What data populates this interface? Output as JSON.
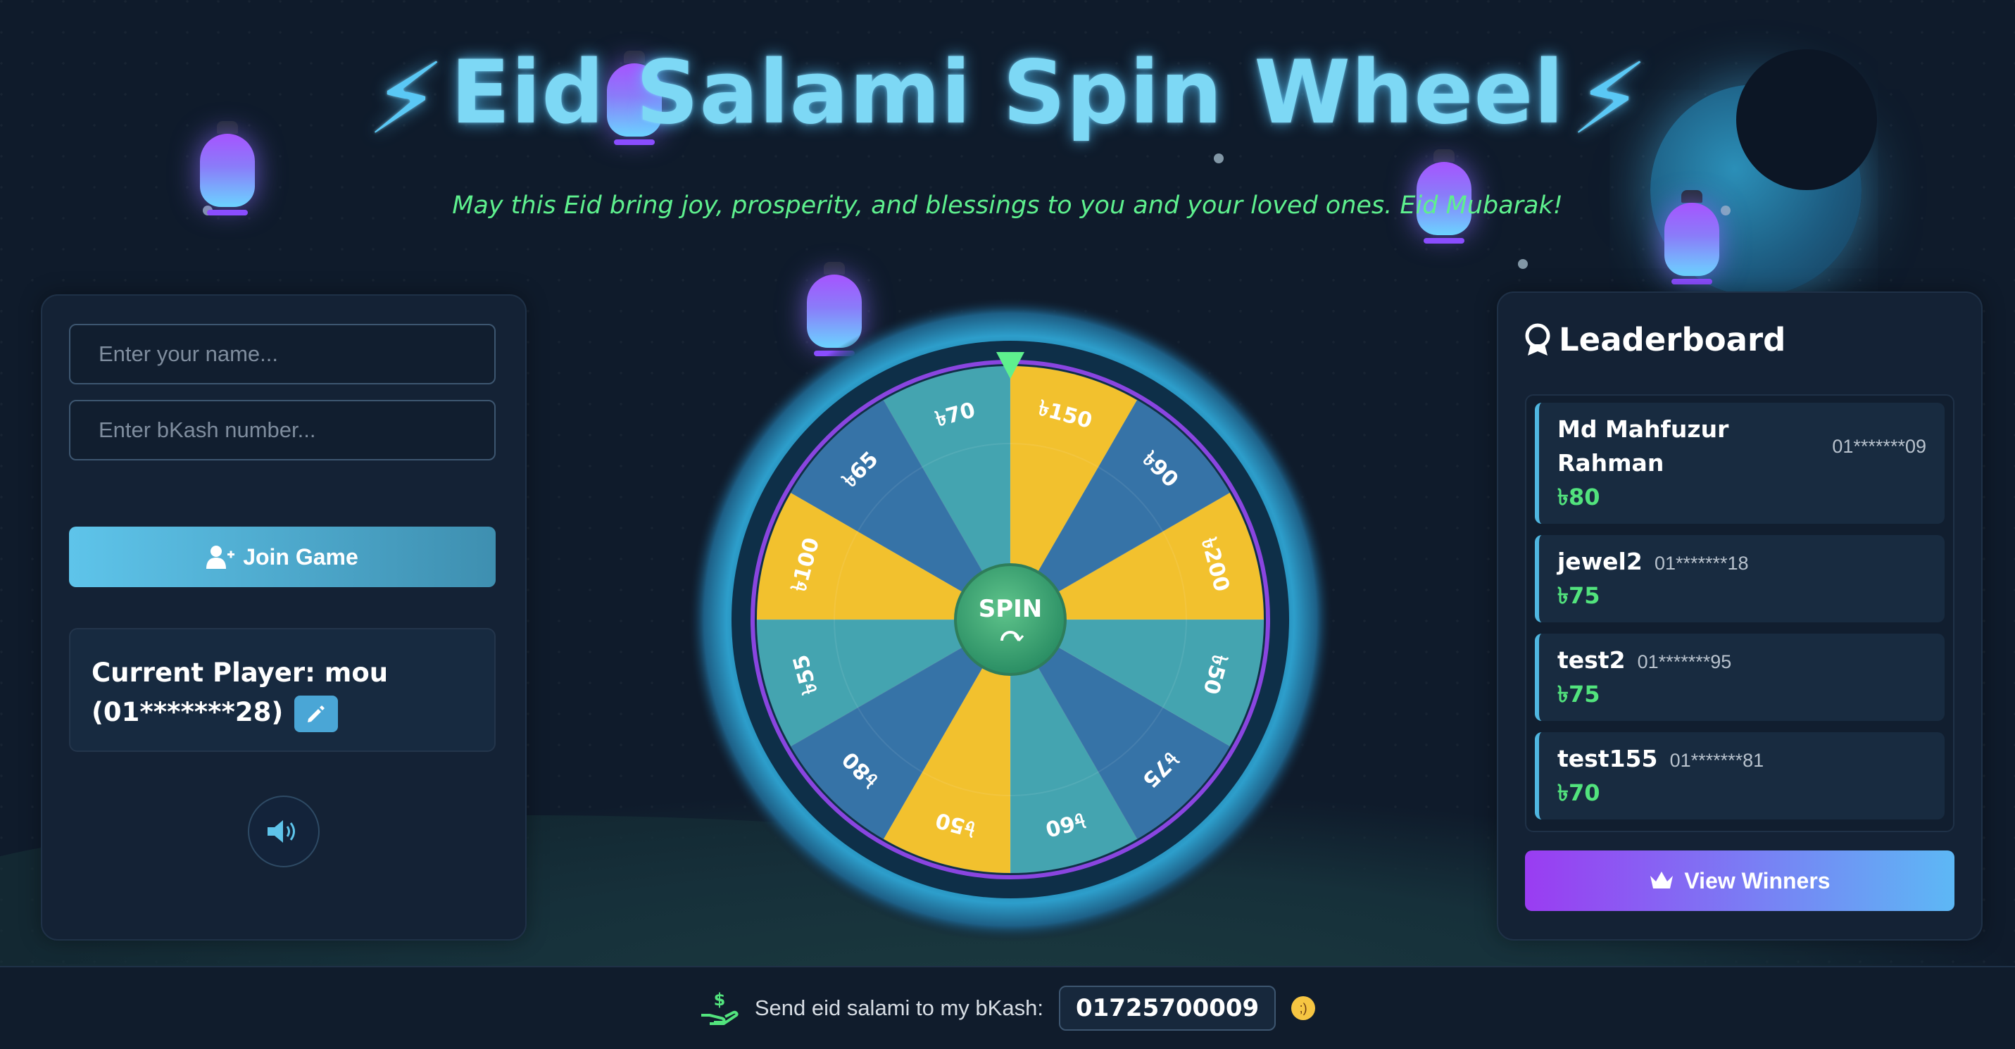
{
  "header": {
    "title": "Eid Salami Spin Wheel",
    "subtitle": "May this Eid bring joy, prosperity, and blessings to you and your loved ones. Eid Mubarak!"
  },
  "form": {
    "name_placeholder": "Enter your name...",
    "bkash_placeholder": "Enter bKash number...",
    "join_label": "Join Game"
  },
  "player": {
    "label": "Current Player: mou",
    "phone": "(01*******28)"
  },
  "wheel": {
    "center_label": "SPIN",
    "segments": [
      "৳150",
      "৳90",
      "৳200",
      "৳50",
      "৳75",
      "৳60",
      "৳50",
      "৳80",
      "৳55",
      "৳100",
      "৳65",
      "৳70"
    ],
    "colors": {
      "yellow": "#f2c12e",
      "blue": "#3673a7",
      "teal": "#44a4b0"
    }
  },
  "leaderboard": {
    "title": "Leaderboard",
    "entries": [
      {
        "name": "Md Mahfuzur Rahman",
        "phone": "01*******09",
        "amount": "৳80"
      },
      {
        "name": "jewel2",
        "phone": "01*******18",
        "amount": "৳75"
      },
      {
        "name": "test2",
        "phone": "01*******95",
        "amount": "৳75"
      },
      {
        "name": "test155",
        "phone": "01*******81",
        "amount": "৳70"
      }
    ],
    "view_winners_label": "View Winners"
  },
  "footer": {
    "text": "Send eid salami to my bKash:",
    "number": "01725700009"
  }
}
